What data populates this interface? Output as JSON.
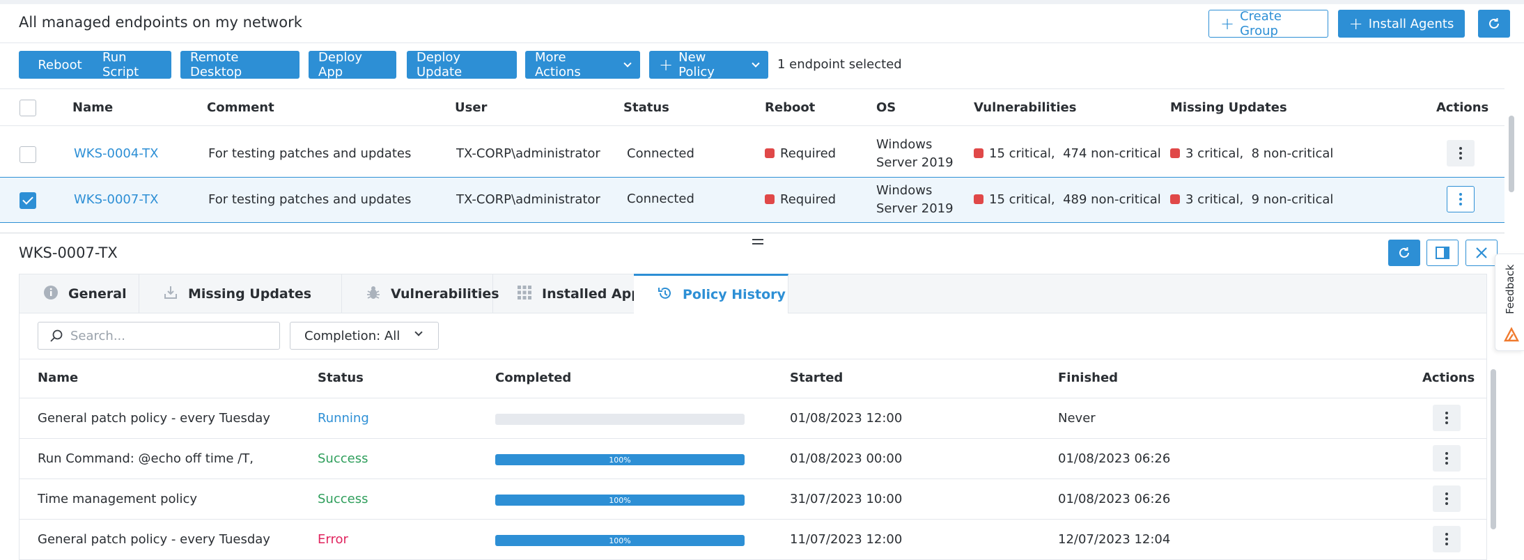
{
  "header": {
    "title": "All managed endpoints on my network",
    "create_group_label": "Create Group",
    "install_agents_label": "Install Agents"
  },
  "toolbar": {
    "reboot_label": "Reboot",
    "run_script_label": "Run Script",
    "remote_desktop_label": "Remote Desktop",
    "deploy_app_label": "Deploy App",
    "deploy_update_label": "Deploy Update",
    "more_actions_label": "More Actions",
    "new_policy_label": "New Policy",
    "selection_text": "1 endpoint selected"
  },
  "endpoints": {
    "columns": [
      "Name",
      "Comment",
      "User",
      "Status",
      "Reboot",
      "OS",
      "Vulnerabilities",
      "Missing Updates",
      "Actions"
    ],
    "rows": [
      {
        "selected": false,
        "name": "WKS-0004-TX",
        "comment": "For testing patches and updates",
        "user": "TX-CORP\\administrator",
        "status": "Connected",
        "reboot": "Required",
        "os_line1": "Windows",
        "os_line2": "Server 2019",
        "vulnerabilities": "15 critical,  474 non-critical",
        "missing_updates": "3 critical,  8 non-critical"
      },
      {
        "selected": true,
        "name": "WKS-0007-TX",
        "comment": "For testing patches and updates",
        "user": "TX-CORP\\administrator",
        "status": "Connected",
        "reboot": "Required",
        "os_line1": "Windows",
        "os_line2": "Server 2019",
        "vulnerabilities": "15 critical,  489 non-critical",
        "missing_updates": "3 critical,  9 non-critical"
      }
    ]
  },
  "detail": {
    "title": "WKS-0007-TX",
    "tabs": [
      {
        "label": "General",
        "icon": "info-icon"
      },
      {
        "label": "Missing Updates",
        "icon": "download-icon"
      },
      {
        "label": "Vulnerabilities",
        "icon": "bug-icon"
      },
      {
        "label": "Installed Apps",
        "icon": "grid-icon"
      },
      {
        "label": "Policy History",
        "icon": "history-icon",
        "active": true
      }
    ],
    "search_placeholder": "Search...",
    "completion_filter": "Completion: All",
    "columns": [
      "Name",
      "Status",
      "Completed",
      "Started",
      "Finished",
      "Actions"
    ],
    "rows": [
      {
        "name": "General patch policy - every Tuesday",
        "status": "Running",
        "completed": 0,
        "completed_label": "",
        "started": "01/08/2023 12:00",
        "finished": "Never"
      },
      {
        "name": "Run Command: @echo off time /T,",
        "status": "Success",
        "completed": 100,
        "completed_label": "100%",
        "started": "01/08/2023 00:00",
        "finished": "01/08/2023 06:26"
      },
      {
        "name": "Time management policy",
        "status": "Success",
        "completed": 100,
        "completed_label": "100%",
        "started": "31/07/2023 10:00",
        "finished": "01/08/2023 06:26"
      },
      {
        "name": "General patch policy - every Tuesday",
        "status": "Error",
        "completed": 100,
        "completed_label": "100%",
        "started": "11/07/2023 12:00",
        "finished": "12/07/2023 12:04"
      }
    ]
  },
  "feedback_label": "Feedback",
  "colors": {
    "accent": "#2d8fd5",
    "success": "#2e9e5b",
    "error": "#e0245e",
    "critical": "#e04848"
  }
}
